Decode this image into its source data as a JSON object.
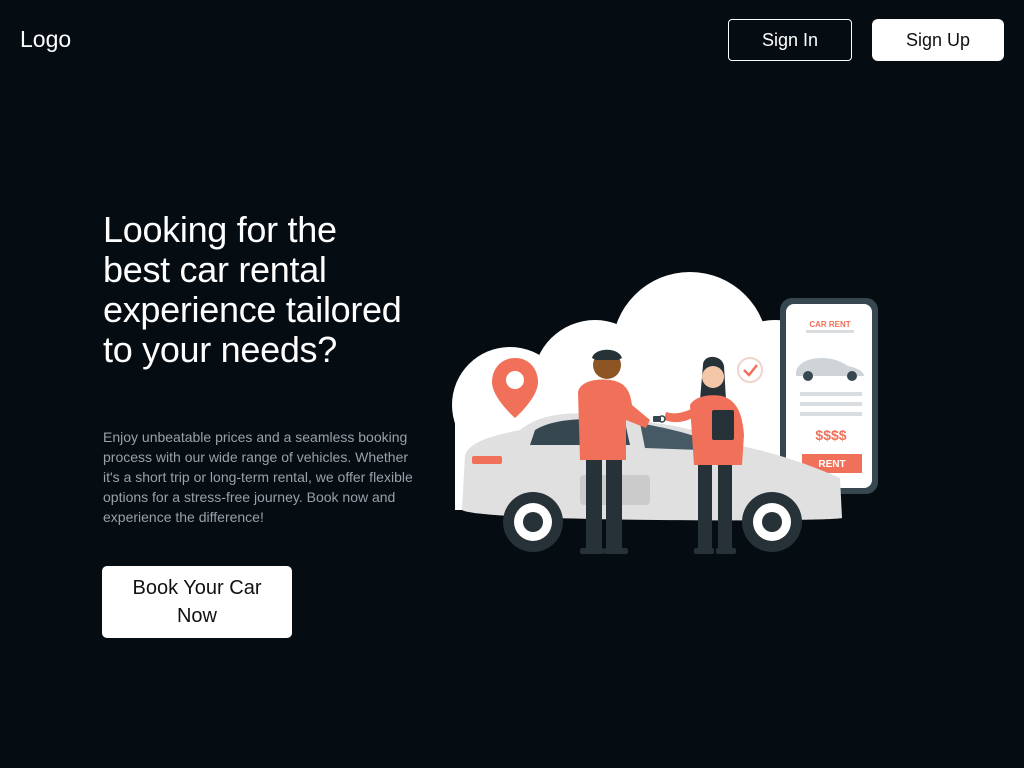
{
  "header": {
    "logo": "Logo",
    "sign_in_label": "Sign In",
    "sign_up_label": "Sign Up"
  },
  "hero": {
    "title": "Looking for the best car rental experience tailored to your needs?",
    "description": "Enjoy unbeatable prices and a seamless booking process with our wide range of vehicles. Whether it's a short trip or long-term rental, we offer flexible options for a stress-free journey. Book now and experience the difference!",
    "cta_label": "Book Your Car Now"
  },
  "illustration": {
    "phone_header": "CAR RENT",
    "price_text": "$$$$",
    "rent_button_label": "RENT"
  },
  "colors": {
    "background": "#050c12",
    "accent": "#f0705a",
    "button_bg": "#ffffff"
  }
}
